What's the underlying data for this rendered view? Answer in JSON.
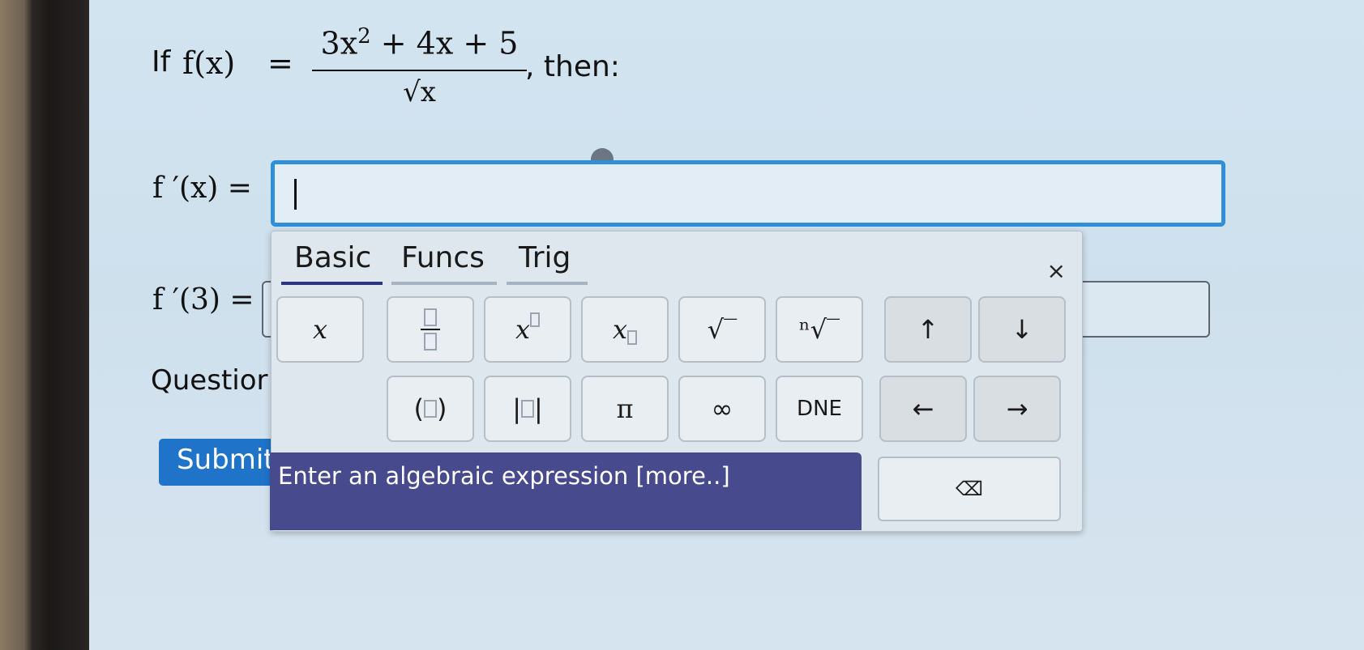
{
  "question": {
    "if_word": "If",
    "function_lhs": "f(x)",
    "equals": "=",
    "numerator_a": "3x",
    "numerator_exp": "2",
    "numerator_b": "+ 4x + 5",
    "denominator": "√x",
    "then": ", then:"
  },
  "answers": {
    "derivative_label": "f ′(x) =",
    "derivative_value": "",
    "at_point_label": "f ′(3) =",
    "at_point_value": ""
  },
  "question_help_label": "Questior",
  "submit_label": "Submit",
  "keypad": {
    "tabs": [
      "Basic",
      "Funcs",
      "Trig"
    ],
    "active_tab": "Basic",
    "close": "×",
    "keys": {
      "x": "x",
      "pow_base": "x",
      "sub_base": "x",
      "sqrt": "√‾",
      "nroot": "ⁿ√‾",
      "up": "↑",
      "down": "↓",
      "paren_open": "(",
      "paren_close": ")",
      "abs_open": "|",
      "abs_close": "|",
      "pi": "π",
      "infinity": "∞",
      "dne": "DNE",
      "left": "←",
      "right": "→",
      "backspace": "⌫"
    },
    "hint": "Enter an algebraic expression [more..]"
  }
}
